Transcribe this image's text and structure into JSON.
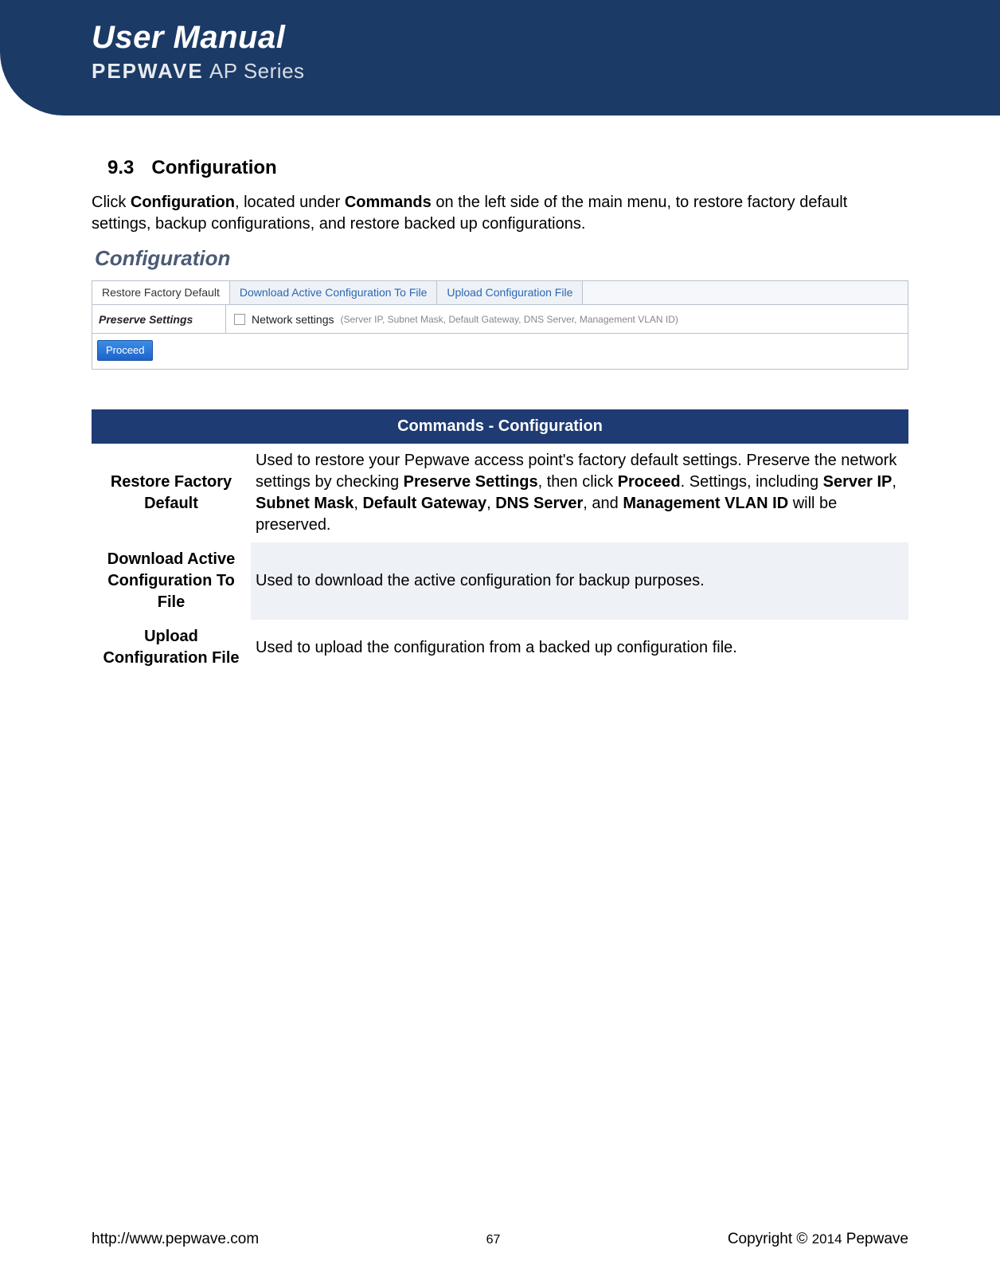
{
  "header": {
    "title": "User Manual",
    "brand": "PEPWAVE",
    "series": "AP Series"
  },
  "section": {
    "number": "9.3",
    "title": "Configuration",
    "intro_pre": "Click ",
    "intro_b1": "Configuration",
    "intro_mid1": ", located under ",
    "intro_b2": "Commands",
    "intro_post": " on the left side of the main menu, to restore factory default settings, backup configurations, and restore backed up configurations."
  },
  "screenshot": {
    "title": "Configuration",
    "tabs": {
      "t1": "Restore Factory Default",
      "t2": "Download Active Configuration To File",
      "t3": "Upload Configuration File"
    },
    "preserve_label": "Preserve Settings",
    "net_label": "Network settings",
    "net_detail": "(Server IP, Subnet Mask, Default Gateway, DNS Server, Management VLAN ID)",
    "proceed": "Proceed"
  },
  "commands_table": {
    "header": "Commands - Configuration",
    "rows": [
      {
        "label": "Restore Factory Default",
        "p1": "Used to restore your Pepwave access point's factory default settings. Preserve the network settings by checking ",
        "b1": "Preserve Settings",
        "p2": ", then click ",
        "b2": "Proceed",
        "p3": ". Settings, including ",
        "b3": "Server IP",
        "p4": ", ",
        "b4": "Subnet Mask",
        "p5": ", ",
        "b5": "Default Gateway",
        "p6": ", ",
        "b6": "DNS Server",
        "p7": ", and ",
        "b7": "Management VLAN ID",
        "p8": " will be preserved."
      },
      {
        "label": "Download Active Configuration To File",
        "desc": "Used to download the active configuration for backup purposes."
      },
      {
        "label": "Upload Configuration File",
        "desc": "Used to upload the configuration from a backed up configuration file."
      }
    ]
  },
  "footer": {
    "url": "http://www.pepwave.com",
    "page": "67",
    "copyright_pre": "Copyright  ©  ",
    "year": "2014",
    "copyright_post": "  Pepwave"
  }
}
